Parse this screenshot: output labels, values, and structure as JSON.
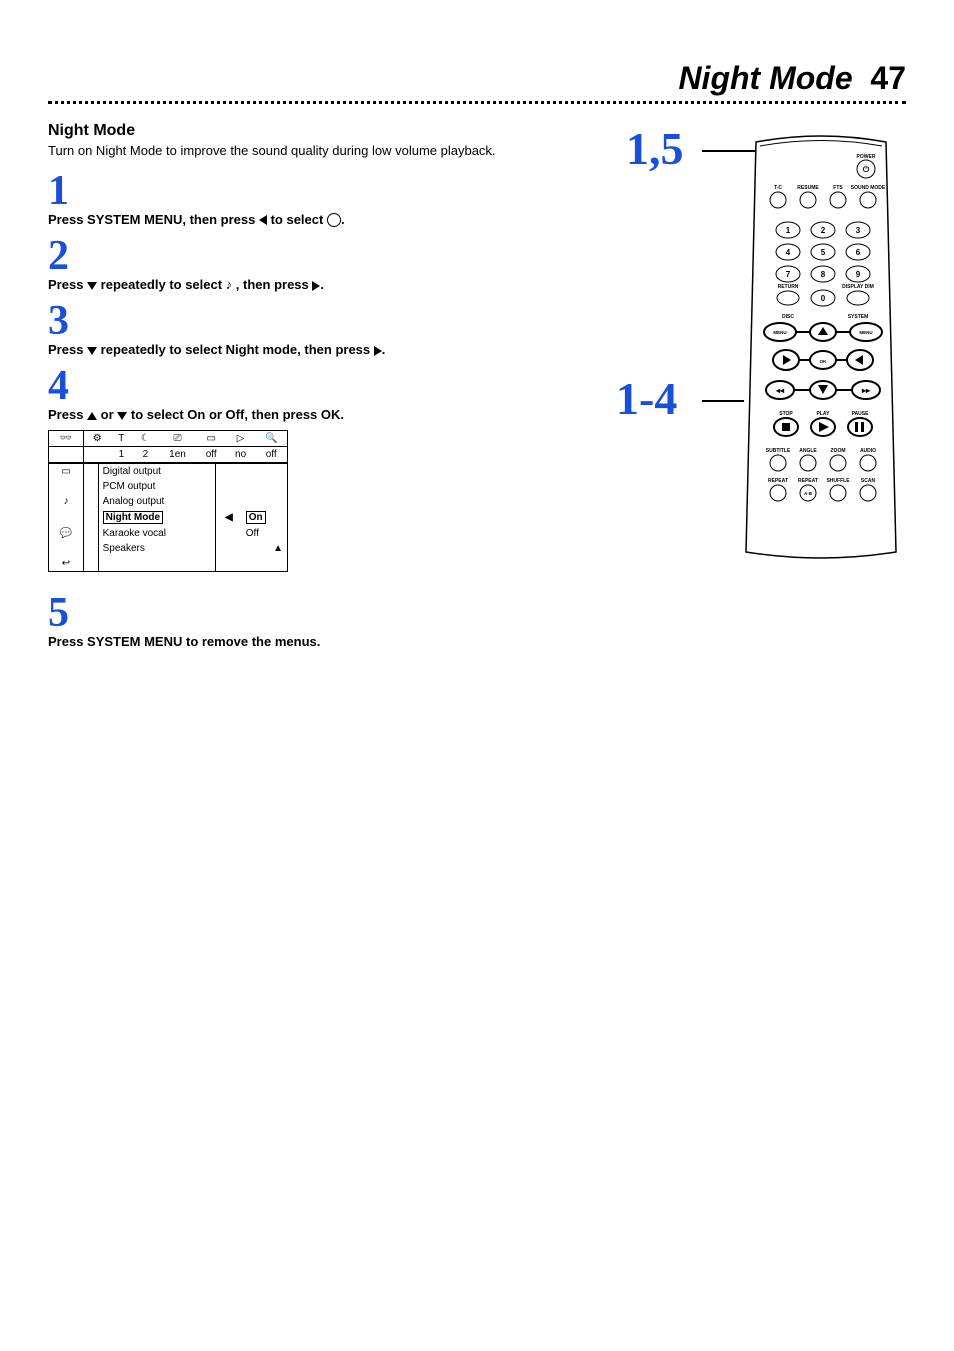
{
  "header": {
    "title": "Night Mode",
    "page": "47"
  },
  "section": {
    "heading": "Night Mode",
    "intro": "Turn on Night Mode to improve the sound quality during low volume playback."
  },
  "steps": {
    "s1": {
      "num": "1",
      "pre": "Press SYSTEM MENU, then press ",
      "post": " to select "
    },
    "s2": {
      "num": "2",
      "pre": "Press ",
      "mid": " repeatedly to select ",
      "post": ", then press "
    },
    "s3": {
      "num": "3",
      "pre": "Press ",
      "mid": " repeatedly to select Night mode, then press "
    },
    "s4": {
      "num": "4",
      "pre": "Press ",
      "mid": " or ",
      "post": " to select On or Off, then press OK."
    },
    "s5": {
      "num": "5",
      "text": "Press SYSTEM MENU to remove the menus."
    }
  },
  "osd": {
    "top": {
      "c1": "1",
      "c2": "2",
      "c3": "1en",
      "c4": "off",
      "c5": "no",
      "c6": "off"
    },
    "rows": {
      "r1": "Digital output",
      "r2": "PCM output",
      "r3": "Analog output",
      "r4": "Night Mode",
      "r5": "Karaoke vocal",
      "r6": "Speakers"
    },
    "opts": {
      "on": "On",
      "off": "Off"
    }
  },
  "callouts": {
    "a": "1,5",
    "b": "1-4"
  },
  "remote": {
    "power": "POWER",
    "row1": {
      "a": "T-C",
      "b": "RESUME",
      "c": "FTS",
      "d": "SOUND MODE"
    },
    "nums": {
      "n1": "1",
      "n2": "2",
      "n3": "3",
      "n4": "4",
      "n5": "5",
      "n6": "6",
      "n7": "7",
      "n8": "8",
      "n9": "9",
      "n0": "0"
    },
    "labels": {
      "ret": "RETURN",
      "dim": "DISPLAY DIM",
      "disc": "DISC",
      "system": "SYSTEM",
      "menuL": "MENU",
      "menuR": "MENU",
      "ok": "OK",
      "stop": "STOP",
      "play": "PLAY",
      "pause": "PAUSE",
      "sub": "SUBTITLE",
      "ang": "ANGLE",
      "zoom": "ZOOM",
      "aud": "AUDIO",
      "rep": "REPEAT",
      "repab_lbl": "REPEAT",
      "ab": "A-B",
      "shuf": "SHUFFLE",
      "scan": "SCAN"
    }
  }
}
